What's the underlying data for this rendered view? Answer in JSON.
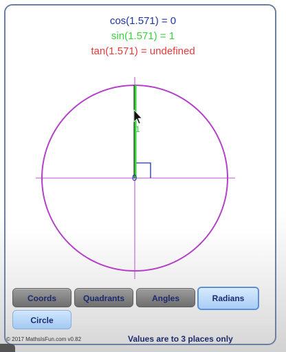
{
  "readouts": {
    "cos": "cos(1.571) = 0",
    "sin": "sin(1.571) = 1",
    "tan": "tan(1.571) = undefined"
  },
  "plot": {
    "origin_label": "0",
    "sin_label": "1",
    "colors": {
      "circle": "#b43fc9",
      "axes": "#c873d8",
      "sin_line": "#36d33a",
      "radius_line": "#111111",
      "right_angle": "#1d33a8",
      "cos_text": "#1d33a8",
      "sin_text": "#36d33a",
      "tan_text": "#e53a3a"
    }
  },
  "buttons": {
    "coords": "Coords",
    "quadrants": "Quadrants",
    "angles": "Angles",
    "radians": "Radians",
    "circle": "Circle"
  },
  "footer": {
    "copyright": "© 2017 MathsIsFun.com v0.82",
    "note": "Values are to 3 places only"
  }
}
